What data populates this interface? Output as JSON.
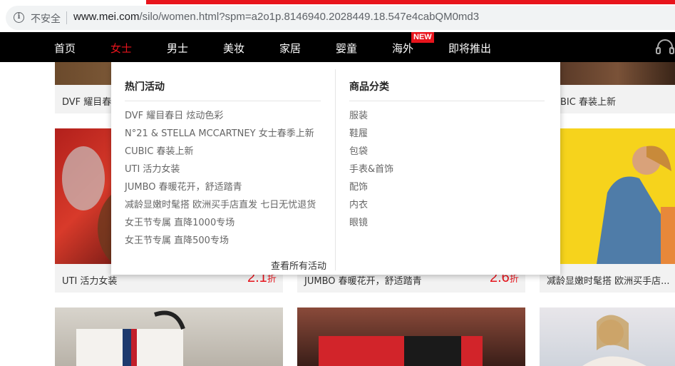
{
  "browser": {
    "insecure_label": "不安全",
    "url_host": "www.mei.com",
    "url_rest": "/silo/women.html?spm=a2o1p.8146940.2028449.18.547e4cabQM0md3"
  },
  "nav": {
    "items": [
      "首页",
      "女士",
      "男士",
      "美妆",
      "家居",
      "婴童",
      "海外",
      "即将推出"
    ],
    "active_index": 1,
    "new_badge": "NEW"
  },
  "tiles": {
    "row1": {
      "left_caption": "DVF  耀目春",
      "right_caption": "BIC  春装上新"
    },
    "row2": [
      {
        "caption": "UTI  活力女装",
        "discount": "2.1",
        "discount_unit": "折"
      },
      {
        "caption": "JUMBO  春暖花开，舒适踏青",
        "discount": "2.6",
        "discount_unit": "折"
      },
      {
        "caption": "减龄显嫩时髦搭  欧洲买手店..."
      }
    ]
  },
  "dropdown": {
    "hot_title": "热门活动",
    "hot_items": [
      "DVF  耀目春日 炫动色彩",
      "N°21 & STELLA MCCARTNEY 女士春季上新",
      "CUBIC 春装上新",
      "UTI  活力女装",
      "JUMBO 春暖花开，舒适踏青",
      "减龄显嫩时髦搭 欧洲买手店直发 七日无忧退货",
      "女王节专属 直降1000专场",
      "女王节专属 直降500专场"
    ],
    "view_all": "查看所有活动",
    "cat_title": "商品分类",
    "cat_items": [
      "服装",
      "鞋履",
      "包袋",
      "手表&首饰",
      "配饰",
      "内衣",
      "眼镜"
    ]
  },
  "colors": {
    "accent": "#e8141c",
    "nav_bg": "#000000",
    "caption_bg": "#f2f2f2"
  }
}
